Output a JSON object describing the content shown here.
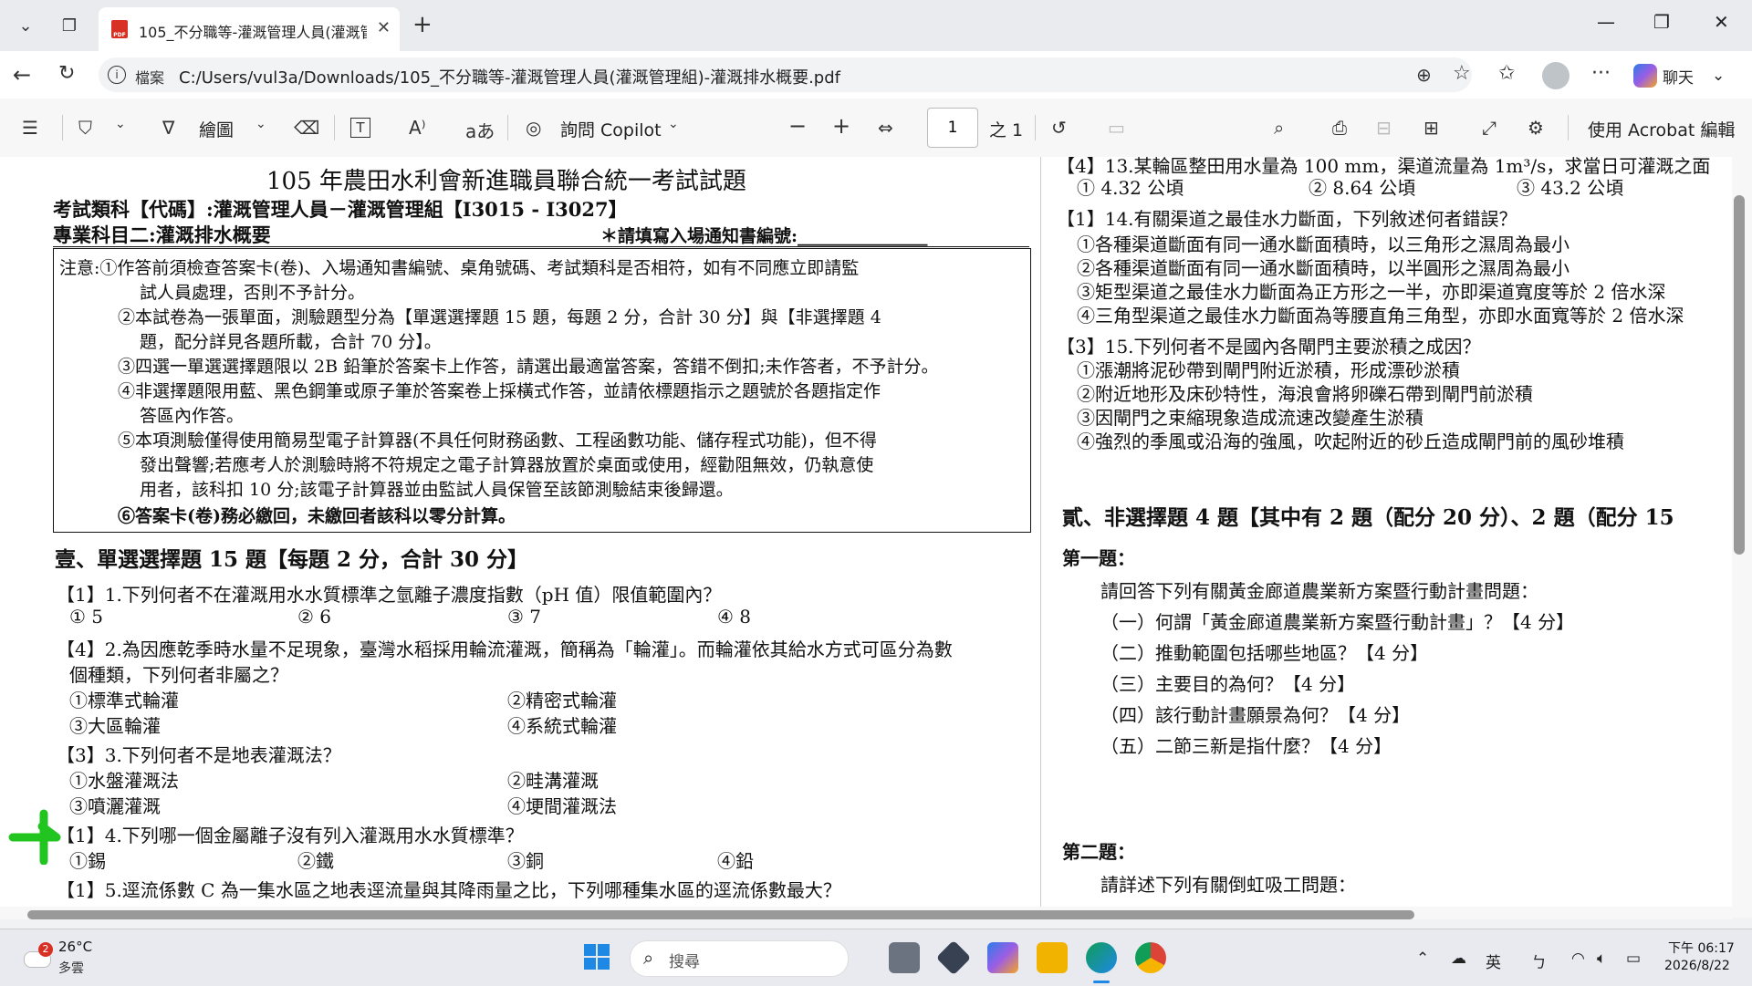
{
  "browser": {
    "tab_title": "105_不分職等-灌溉管理人員(灌溉管",
    "file_label": "檔案",
    "url": "C:/Users/vul3a/Downloads/105_不分職等-灌溉管理人員(灌溉管理組)-灌溉排水概要.pdf",
    "chat_label": "聊天",
    "pdf_badge": "PDF"
  },
  "pdf_toolbar": {
    "draw_label": "繪圖",
    "ask_copilot": "詢問 Copilot",
    "page_current": "1",
    "page_total": "之 1",
    "acrobat_label": "使用 Acrobat 編輯"
  },
  "exam": {
    "title": "105 年農田水利會新進職員聯合統一考試試題",
    "category": "考試類科【代碼】:灌溉管理人員－灌溉管理組【I3015 - I3027】",
    "subject": "專業科目二:灌溉排水概要",
    "fill_id": "＊請填寫入場通知書編號:_______________",
    "notice": [
      "注意:①作答前須檢查答案卡(卷)、入場通知書編號、桌角號碼、考試類科是否相符，如有不同應立即請監",
      "試人員處理，否則不予計分。",
      "②本試卷為一張單面，測驗題型分為【單選選擇題 15 題，每題 2 分，合計 30 分】與【非選擇題 4",
      "題，配分詳見各題所載，合計 70 分】。",
      "③四選一單選選擇題限以 2B 鉛筆於答案卡上作答，請選出最適當答案，答錯不倒扣;未作答者，不予計分。",
      "④非選擇題限用藍、黑色鋼筆或原子筆於答案卷上採橫式作答，並請依標題指示之題號於各題指定作",
      "答區內作答。",
      "⑤本項測驗僅得使用簡易型電子計算器(不具任何財務函數、工程函數功能、儲存程式功能)，但不得",
      "發出聲響;若應考人於測驗時將不符規定之電子計算器放置於桌面或使用，經勸阻無效，仍執意使",
      "用者，該科扣 10 分;該電子計算器並由監試人員保管至該節測驗結束後歸還。",
      "⑥答案卡(卷)務必繳回，未繳回者該科以零分計算。"
    ],
    "section1": "壹、單選選擇題 15 題【每題 2 分，合計 30 分】",
    "q1": "【1】1.下列何者不在灌溉用水水質標準之氫離子濃度指數（pH 值）限值範圍內？",
    "q1_opts": [
      "① 5",
      "② 6",
      "③ 7",
      "④ 8"
    ],
    "q2a": "【4】2.為因應乾季時水量不足現象，臺灣水稻採用輪流灌溉，簡稱為「輪灌」。而輪灌依其給水方式可區分為數",
    "q2b": "個種類，下列何者非屬之？",
    "q2_opts": [
      "①標準式輪灌",
      "②精密式輪灌",
      "③大區輪灌",
      "④系統式輪灌"
    ],
    "q3": "【3】3.下列何者不是地表灌溉法？",
    "q3_opts": [
      "①水盤灌溉法",
      "②畦溝灌溉",
      "③噴灑灌溉",
      "④埂間灌溉法"
    ],
    "q4": "【1】4.下列哪一個金屬離子沒有列入灌溉用水水質標準？",
    "q4_opts": [
      "①錫",
      "②鐵",
      "③銅",
      "④鉛"
    ],
    "q5": "【1】5.逕流係數 C 為一集水區之地表逕流量與其降雨量之比，下列哪種集水區的逕流係數最大？",
    "q13a": "【4】13.某輪區整田用水量為 100 mm，渠道流量為 1m³/s，求當日可灌溉之面",
    "q13_opts": [
      "① 4.32 公頃",
      "② 8.64 公頃",
      "③ 43.2 公頃"
    ],
    "q14": "【1】14.有關渠道之最佳水力斷面，下列敘述何者錯誤？",
    "q14_opts": [
      "①各種渠道斷面有同一通水斷面積時，以三角形之濕周為最小",
      "②各種渠道斷面有同一通水斷面積時，以半圓形之濕周為最小",
      "③矩型渠道之最佳水力斷面為正方形之一半，亦即渠道寬度等於 2 倍水深",
      "④三角型渠道之最佳水力斷面為等腰直角三角型，亦即水面寬等於 2 倍水深"
    ],
    "q15": "【3】15.下列何者不是國內各閘門主要淤積之成因？",
    "q15_opts": [
      "①漲潮將泥砂帶到閘門附近淤積，形成漂砂淤積",
      "②附近地形及床砂特性，海浪會將卵礫石帶到閘門前淤積",
      "③因閘門之束縮現象造成流速改變產生淤積",
      "④強烈的季風或沿海的強風，吹起附近的砂丘造成閘門前的風砂堆積"
    ],
    "section2": "貳、非選擇題 4 題【其中有 2 題（配分 20 分）、2 題（配分 15",
    "p1_title": "第一題：",
    "p1_intro": "請回答下列有關黃金廊道農業新方案暨行動計畫問題：",
    "p1_items": [
      "（一）何謂「黃金廊道農業新方案暨行動計畫」？【4 分】",
      "（二）推動範圍包括哪些地區？【4 分】",
      "（三）主要目的為何？【4 分】",
      "（四）該行動計畫願景為何？【4 分】",
      "（五）二節三新是指什麼？【4 分】"
    ],
    "p2_title": "第二題：",
    "p2_intro": "請詳述下列有關倒虹吸工問題："
  },
  "taskbar": {
    "temp": "26°C",
    "weather": "多雲",
    "weather_badge": "2",
    "search_placeholder": "搜尋",
    "ime": "英",
    "time": "下午 06:17",
    "date": "2026/8/22"
  }
}
